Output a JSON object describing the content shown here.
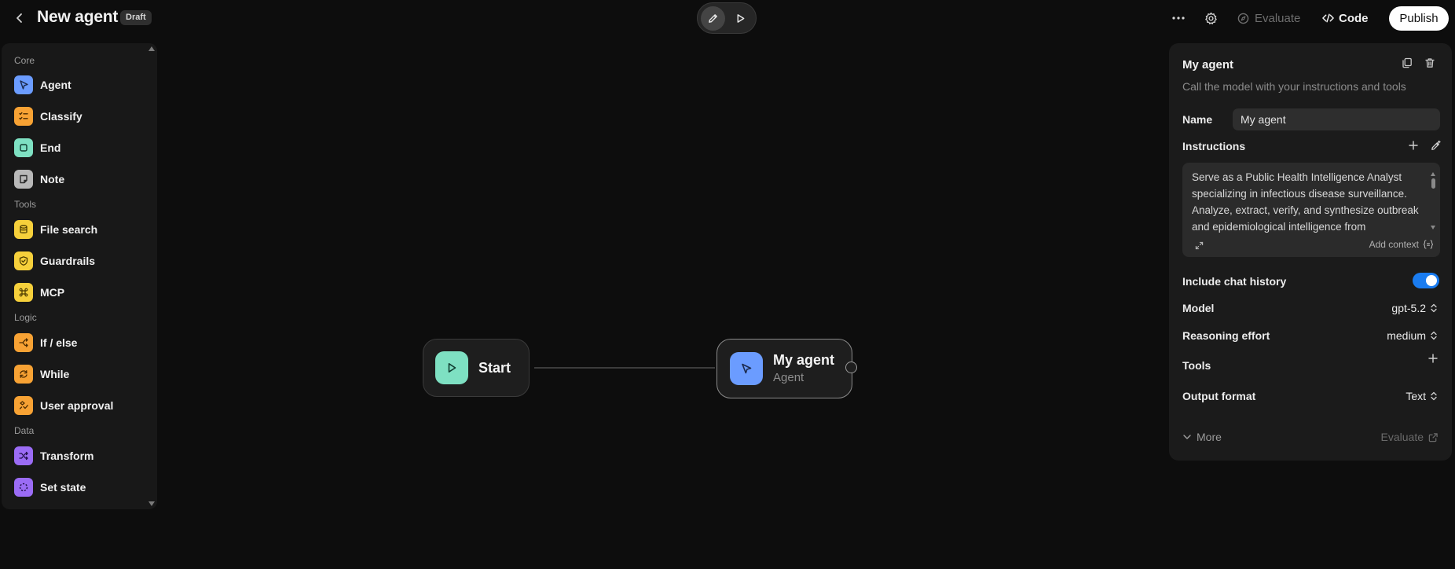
{
  "header": {
    "title": "New agent",
    "badge": "Draft",
    "evaluate_label": "Evaluate",
    "code_label": "Code",
    "publish_label": "Publish"
  },
  "palette": {
    "sections": [
      {
        "title": "Core",
        "items": [
          {
            "label": "Agent",
            "icon": "cursor-arrow-icon",
            "color": "#6b9cff"
          },
          {
            "label": "Classify",
            "icon": "list-icon",
            "color": "#f7a234"
          },
          {
            "label": "End",
            "icon": "stop-square-icon",
            "color": "#7ee0c2"
          },
          {
            "label": "Note",
            "icon": "note-icon",
            "color": "#b8b8b8"
          }
        ]
      },
      {
        "title": "Tools",
        "items": [
          {
            "label": "File search",
            "icon": "database-icon",
            "color": "#f6d03b"
          },
          {
            "label": "Guardrails",
            "icon": "shield-check-icon",
            "color": "#f6d03b"
          },
          {
            "label": "MCP",
            "icon": "command-icon",
            "color": "#f6d03b"
          }
        ]
      },
      {
        "title": "Logic",
        "items": [
          {
            "label": "If / else",
            "icon": "branch-icon",
            "color": "#f7a234"
          },
          {
            "label": "While",
            "icon": "loop-icon",
            "color": "#f7a234"
          },
          {
            "label": "User approval",
            "icon": "approval-icon",
            "color": "#f7a234"
          }
        ]
      },
      {
        "title": "Data",
        "items": [
          {
            "label": "Transform",
            "icon": "shuffle-icon",
            "color": "#9b6cf5"
          },
          {
            "label": "Set state",
            "icon": "dashed-circle-icon",
            "color": "#9b6cf5"
          }
        ]
      }
    ]
  },
  "canvas": {
    "start_node": {
      "title": "Start",
      "icon": "play-icon",
      "color": "#7ee0c2"
    },
    "agent_node": {
      "title": "My agent",
      "subtitle": "Agent",
      "icon": "cursor-arrow-icon",
      "color": "#6b9cff"
    }
  },
  "inspector": {
    "title": "My agent",
    "description": "Call the model with your instructions and tools",
    "name_label": "Name",
    "name_value": "My agent",
    "instructions_label": "Instructions",
    "instructions_text": "Serve as a Public Health Intelligence Analyst specializing in infectious disease surveillance. Analyze, extract, verify, and synthesize outbreak and epidemiological intelligence from",
    "add_context_label": "Add context",
    "chat_history_label": "Include chat history",
    "chat_history_on": true,
    "model_label": "Model",
    "model_value": "gpt-5.2",
    "reasoning_label": "Reasoning effort",
    "reasoning_value": "medium",
    "tools_label": "Tools",
    "output_label": "Output format",
    "output_value": "Text",
    "more_label": "More",
    "evaluate_label": "Evaluate",
    "accent": "#1a7cf0"
  }
}
